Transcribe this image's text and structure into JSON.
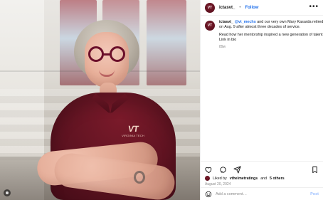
{
  "post": {
    "username": "ictasvt_",
    "follow_label": "Follow",
    "more_label": "•••",
    "caption": {
      "username": "ictasvt_",
      "mention": "@vt_mechs",
      "text_part1": "and our very own Mary Kasarda retired on Aug. 9 after almost three decades of service.",
      "text_part2": "Read how her mentorship inspired a new generation of talent. Link in bio",
      "age": "89w"
    },
    "likes": {
      "prefix": "Liked by",
      "by_user": "vthelmetratings",
      "and": "and",
      "others": "5 others"
    },
    "date": "August 20, 2024",
    "comment": {
      "placeholder": "Add a comment…",
      "post_label": "Post"
    }
  },
  "photo": {
    "logo": {
      "vt": "VT",
      "sub": "VIRGINIA TECH"
    }
  },
  "icons": {
    "like": "heart-icon",
    "comment": "comment-icon",
    "share": "share-icon",
    "save": "bookmark-icon",
    "emoji": "smiley-icon",
    "more": "ellipsis-icon",
    "media": "media-indicator-icon"
  },
  "colors": {
    "link": "#1f6feb",
    "post_disabled": "#9ec1ff",
    "maroon": "#5f1321"
  }
}
